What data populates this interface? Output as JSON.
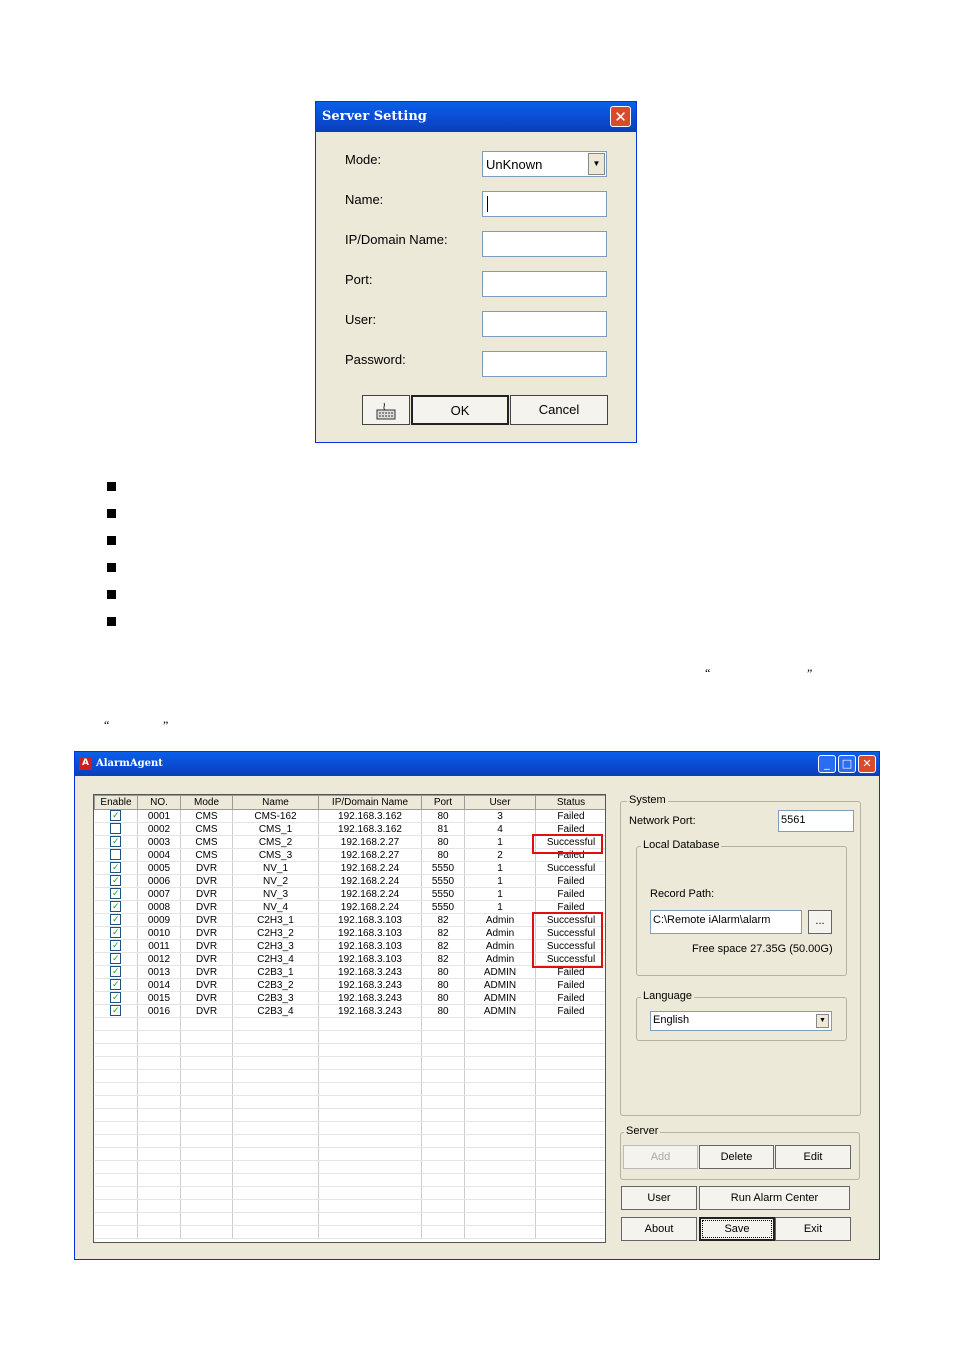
{
  "server_setting": {
    "title": "Server Setting",
    "close_glyph": "✕",
    "labels": {
      "mode": "Mode:",
      "name": "Name:",
      "ip": "IP/Domain Name:",
      "port": "Port:",
      "user": "User:",
      "password": "Password:"
    },
    "mode_value": "UnKnown",
    "ok_label": "OK",
    "cancel_label": "Cancel"
  },
  "quotes": {
    "open": "“",
    "close": "”"
  },
  "alarm_agent": {
    "title": "AlarmAgent",
    "columns": [
      "Enable",
      "NO.",
      "Mode",
      "Name",
      "IP/Domain Name",
      "Port",
      "User",
      "Status"
    ],
    "rows": [
      {
        "enabled": true,
        "no": "0001",
        "mode": "CMS",
        "name": "CMS-162",
        "ip": "192.168.3.162",
        "port": "80",
        "user": "3",
        "status": "Failed"
      },
      {
        "enabled": false,
        "no": "0002",
        "mode": "CMS",
        "name": "CMS_1",
        "ip": "192.168.3.162",
        "port": "81",
        "user": "4",
        "status": "Failed"
      },
      {
        "enabled": true,
        "no": "0003",
        "mode": "CMS",
        "name": "CMS_2",
        "ip": "192.168.2.27",
        "port": "80",
        "user": "1",
        "status": "Successful"
      },
      {
        "enabled": false,
        "no": "0004",
        "mode": "CMS",
        "name": "CMS_3",
        "ip": "192.168.2.27",
        "port": "80",
        "user": "2",
        "status": "Failed"
      },
      {
        "enabled": true,
        "no": "0005",
        "mode": "DVR",
        "name": "NV_1",
        "ip": "192.168.2.24",
        "port": "5550",
        "user": "1",
        "status": "Successful"
      },
      {
        "enabled": true,
        "no": "0006",
        "mode": "DVR",
        "name": "NV_2",
        "ip": "192.168.2.24",
        "port": "5550",
        "user": "1",
        "status": "Failed"
      },
      {
        "enabled": true,
        "no": "0007",
        "mode": "DVR",
        "name": "NV_3",
        "ip": "192.168.2.24",
        "port": "5550",
        "user": "1",
        "status": "Failed"
      },
      {
        "enabled": true,
        "no": "0008",
        "mode": "DVR",
        "name": "NV_4",
        "ip": "192.168.2.24",
        "port": "5550",
        "user": "1",
        "status": "Failed"
      },
      {
        "enabled": true,
        "no": "0009",
        "mode": "DVR",
        "name": "C2H3_1",
        "ip": "192.168.3.103",
        "port": "82",
        "user": "Admin",
        "status": "Successful"
      },
      {
        "enabled": true,
        "no": "0010",
        "mode": "DVR",
        "name": "C2H3_2",
        "ip": "192.168.3.103",
        "port": "82",
        "user": "Admin",
        "status": "Successful"
      },
      {
        "enabled": true,
        "no": "0011",
        "mode": "DVR",
        "name": "C2H3_3",
        "ip": "192.168.3.103",
        "port": "82",
        "user": "Admin",
        "status": "Successful"
      },
      {
        "enabled": true,
        "no": "0012",
        "mode": "DVR",
        "name": "C2H3_4",
        "ip": "192.168.3.103",
        "port": "82",
        "user": "Admin",
        "status": "Successful"
      },
      {
        "enabled": true,
        "no": "0013",
        "mode": "DVR",
        "name": "C2B3_1",
        "ip": "192.168.3.243",
        "port": "80",
        "user": "ADMIN",
        "status": "Failed"
      },
      {
        "enabled": true,
        "no": "0014",
        "mode": "DVR",
        "name": "C2B3_2",
        "ip": "192.168.3.243",
        "port": "80",
        "user": "ADMIN",
        "status": "Failed"
      },
      {
        "enabled": true,
        "no": "0015",
        "mode": "DVR",
        "name": "C2B3_3",
        "ip": "192.168.3.243",
        "port": "80",
        "user": "ADMIN",
        "status": "Failed"
      },
      {
        "enabled": true,
        "no": "0016",
        "mode": "DVR",
        "name": "C2B3_4",
        "ip": "192.168.3.243",
        "port": "80",
        "user": "ADMIN",
        "status": "Failed"
      }
    ],
    "system": {
      "group_label": "System",
      "network_port_label": "Network Port:",
      "network_port_value": "5561",
      "local_db_label": "Local Database",
      "record_path_label": "Record Path:",
      "record_path_value": "C:\\Remote iAlarm\\alarm",
      "browse_label": "...",
      "free_space": "Free space 27.35G (50.00G)"
    },
    "language": {
      "group_label": "Language",
      "value": "English"
    },
    "server": {
      "group_label": "Server",
      "add_label": "Add",
      "delete_label": "Delete",
      "edit_label": "Edit"
    },
    "buttons": {
      "user": "User",
      "run_alarm_center": "Run Alarm Center",
      "about": "About",
      "save": "Save",
      "exit": "Exit"
    },
    "colors": {
      "highlight": "#e01010",
      "titlebar": "#0a4ad0"
    }
  }
}
